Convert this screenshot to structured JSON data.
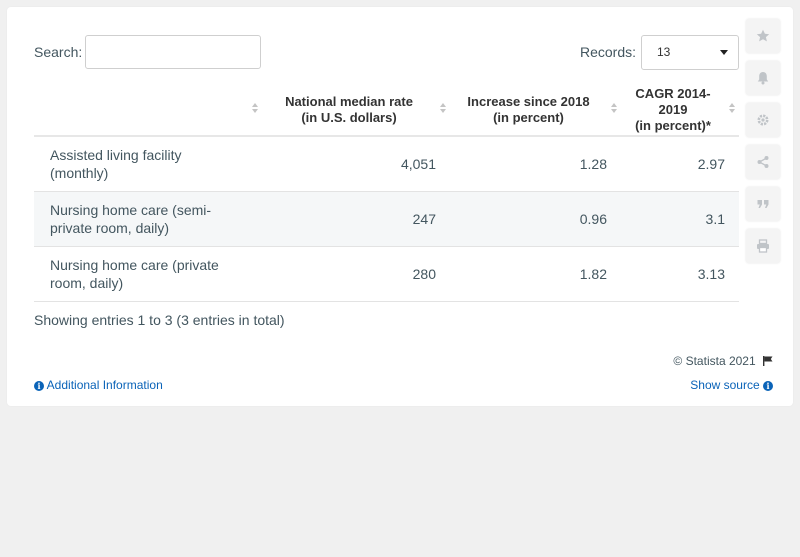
{
  "search": {
    "label": "Search:",
    "value": "",
    "placeholder": ""
  },
  "records": {
    "label": "Records:",
    "value": "13"
  },
  "table": {
    "headers": [
      "",
      "National median rate (in U.S. dollars)",
      "Increase since 2018 (in percent)",
      "CAGR 2014-2019 (in percent)*"
    ],
    "header_lines": [
      [
        "National median rate",
        "(in U.S. dollars)"
      ],
      [
        "Increase since 2018",
        "(in percent)"
      ],
      [
        "CAGR 2014-2019",
        "(in percent)*"
      ]
    ],
    "rows": [
      {
        "name_lines": [
          "Assisted living facility",
          "(monthly)"
        ],
        "name": "Assisted living facility (monthly)",
        "rate": "4,051",
        "increase": "1.28",
        "cagr": "2.97"
      },
      {
        "name_lines": [
          "Nursing home care (semi-",
          "private room, daily)"
        ],
        "name": "Nursing home care (semi-private room, daily)",
        "rate": "247",
        "increase": "0.96",
        "cagr": "3.1"
      },
      {
        "name_lines": [
          "Nursing home care (private",
          "room, daily)"
        ],
        "name": "Nursing home care (private room, daily)",
        "rate": "280",
        "increase": "1.82",
        "cagr": "3.13"
      }
    ]
  },
  "footer": {
    "showing": "Showing entries 1 to 3 (3 entries in total)",
    "copyright": "© Statista 2021",
    "additional_info": "Additional Information",
    "show_source": "Show source"
  },
  "sidebar_icons": [
    "star-icon",
    "bell-icon",
    "gear-icon",
    "share-icon",
    "quote-icon",
    "print-icon"
  ],
  "colors": {
    "link": "#0a63b8",
    "text": "#43565f",
    "row_alt": "#f5f7f8",
    "icon": "#c0c4c8"
  }
}
